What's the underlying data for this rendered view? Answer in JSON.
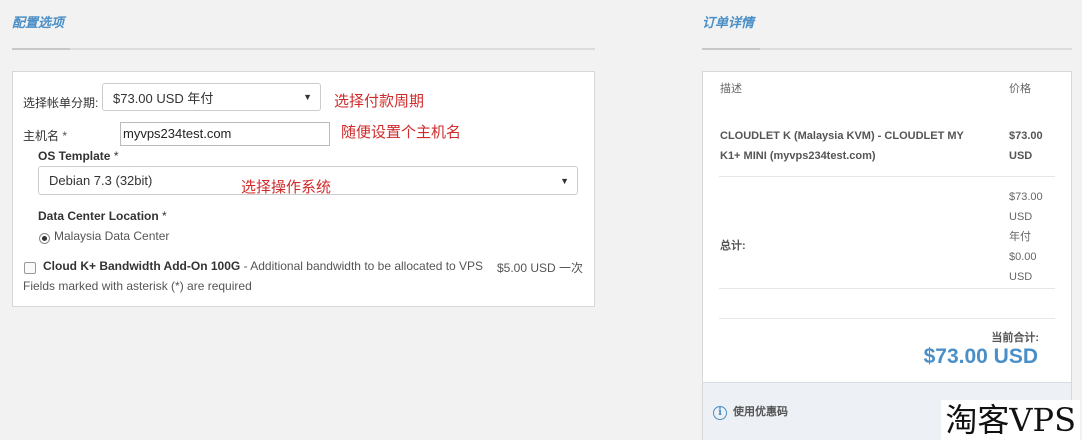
{
  "config": {
    "section_title": "配置选项",
    "billing_label": "选择帐单分期:",
    "billing_value": "$73.00 USD 年付",
    "billing_note": "选择付款周期",
    "hostname_label": "主机名",
    "required_mark": "*",
    "hostname_value": "myvps234test.com",
    "hostname_note": "随便设置个主机名",
    "os_label": "OS Template",
    "os_value": "Debian 7.3 (32bit)",
    "os_note": "选择操作系统",
    "dc_label": "Data Center Location",
    "dc_option": "Malaysia Data Center",
    "addon_name": "Cloud K+ Bandwidth Add-On 100G",
    "addon_desc": " - Additional bandwidth to be allocated to VPS",
    "addon_price": "$5.00 USD 一次",
    "footer_note": "Fields marked with asterisk (*) are required"
  },
  "order": {
    "section_title": "订单详情",
    "col_desc": "描述",
    "col_price": "价格",
    "item_line1": "CLOUDLET K (Malaysia KVM) - CLOUDLET MY",
    "item_line2": "K1+ MINI (myvps234test.com)",
    "item_price_line1": "$73.00",
    "item_price_line2": "USD",
    "total_label": "总计:",
    "total_lines": [
      "$73.00",
      "USD",
      "年付",
      "$0.00",
      "USD"
    ],
    "current_total_label": "当前合计:",
    "current_total_value": "$73.00 USD",
    "promo_label": "使用优惠码"
  },
  "icons": {
    "select_caret": "caret-down-icon",
    "info": "info-icon"
  },
  "colors": {
    "accent": "#4a8fc7",
    "annotation": "#d02b2b"
  },
  "watermark": "淘客VPS"
}
